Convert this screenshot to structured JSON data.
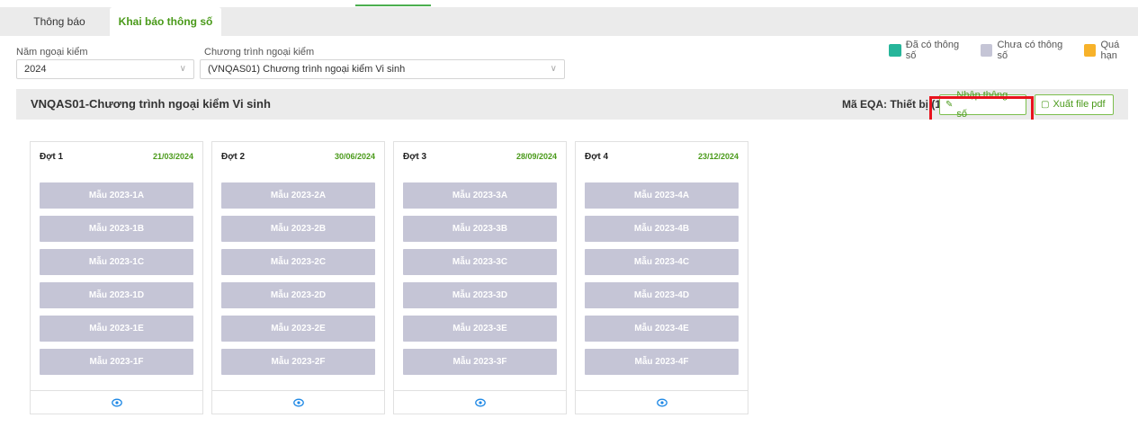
{
  "tabs": [
    {
      "label": "Thông báo"
    },
    {
      "label": "Khai báo thông số"
    }
  ],
  "filters": {
    "year_label": "Năm ngoại kiểm",
    "year_value": "2024",
    "program_label": "Chương trình ngoại kiểm",
    "program_value": "(VNQAS01) Chương trình ngoại kiểm Vi sinh"
  },
  "legend": [
    {
      "label": "Đã có thông số",
      "color": "#26b59a"
    },
    {
      "label": "Chưa có thông số",
      "color": "#c5c5d6"
    },
    {
      "label": "Quá hạn",
      "color": "#f7b22a"
    }
  ],
  "panel": {
    "title": "VNQAS01-Chương trình ngoại kiểm Vi sinh",
    "eqa_label": "Mã EQA: Thiết bị (1 ):",
    "import_button": "Nhập thông số",
    "pdf_button": "Xuất file pdf"
  },
  "rounds": [
    {
      "name": "Đợt 1",
      "date": "21/03/2024",
      "samples": [
        "Mẫu 2023-1A",
        "Mẫu 2023-1B",
        "Mẫu 2023-1C",
        "Mẫu 2023-1D",
        "Mẫu 2023-1E",
        "Mẫu 2023-1F"
      ]
    },
    {
      "name": "Đợt 2",
      "date": "30/06/2024",
      "samples": [
        "Mẫu 2023-2A",
        "Mẫu 2023-2B",
        "Mẫu 2023-2C",
        "Mẫu 2023-2D",
        "Mẫu 2023-2E",
        "Mẫu 2023-2F"
      ]
    },
    {
      "name": "Đợt 3",
      "date": "28/09/2024",
      "samples": [
        "Mẫu 2023-3A",
        "Mẫu 2023-3B",
        "Mẫu 2023-3C",
        "Mẫu 2023-3D",
        "Mẫu 2023-3E",
        "Mẫu 2023-3F"
      ]
    },
    {
      "name": "Đợt 4",
      "date": "23/12/2024",
      "samples": [
        "Mẫu 2023-4A",
        "Mẫu 2023-4B",
        "Mẫu 2023-4C",
        "Mẫu 2023-4D",
        "Mẫu 2023-4E",
        "Mẫu 2023-4F"
      ]
    }
  ],
  "colors": {
    "accent_green": "#4a9a1a",
    "annotation_red": "#e8121c",
    "sample_pending": "#c5c5d6",
    "eye_icon": "#1e88e5"
  }
}
